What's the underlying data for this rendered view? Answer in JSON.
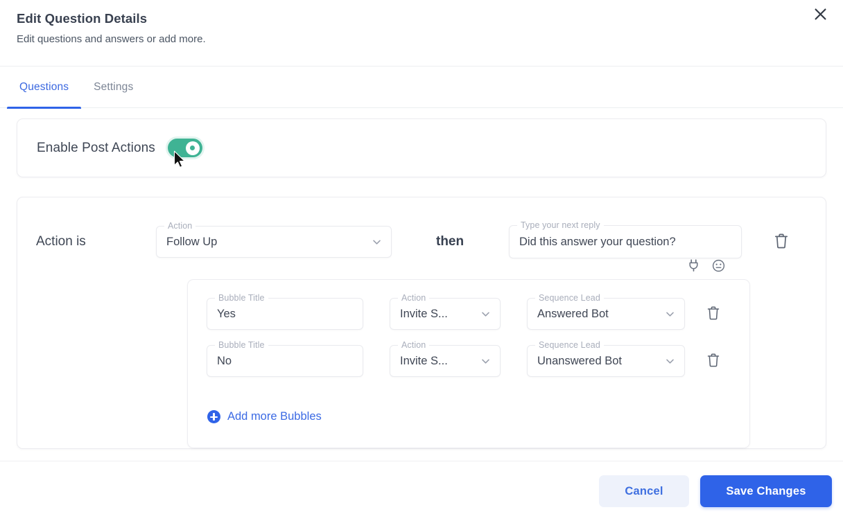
{
  "dialog": {
    "title": "Edit Question Details",
    "subtitle": "Edit questions and answers or add more.",
    "close_icon": "close-icon"
  },
  "tabs": [
    {
      "label": "Questions",
      "active": true
    },
    {
      "label": "Settings",
      "active": false
    }
  ],
  "enable_section": {
    "label": "Enable Post Actions",
    "toggle_on": true,
    "toggle_color": "#3fb394"
  },
  "action_row": {
    "prefix_label": "Action is",
    "action_field": {
      "legend": "Action",
      "value": "Follow Up",
      "chevron_icon": "chevron-down-icon"
    },
    "connector_label": "then",
    "reply_field": {
      "legend": "Type your next reply",
      "value": "Did this answer your question?",
      "icons": [
        "plug-icon",
        "emoji-icon"
      ]
    },
    "delete_icon": "trash-icon"
  },
  "bubbles": {
    "rows": [
      {
        "title_field": {
          "legend": "Bubble Title",
          "value": "Yes"
        },
        "action_field": {
          "legend": "Action",
          "value": "Invite S..."
        },
        "sequence_field": {
          "legend": "Sequence Lead",
          "value": "Answered Bot"
        },
        "delete_icon": "trash-icon"
      },
      {
        "title_field": {
          "legend": "Bubble Title",
          "value": "No"
        },
        "action_field": {
          "legend": "Action",
          "value": "Invite S..."
        },
        "sequence_field": {
          "legend": "Sequence Lead",
          "value": "Unanswered Bot"
        },
        "delete_icon": "trash-icon"
      }
    ],
    "add_more_label": "Add more Bubbles",
    "add_icon": "plus-circle-icon"
  },
  "footer": {
    "cancel_label": "Cancel",
    "save_label": "Save Changes",
    "accent_color": "#2f63e8"
  }
}
